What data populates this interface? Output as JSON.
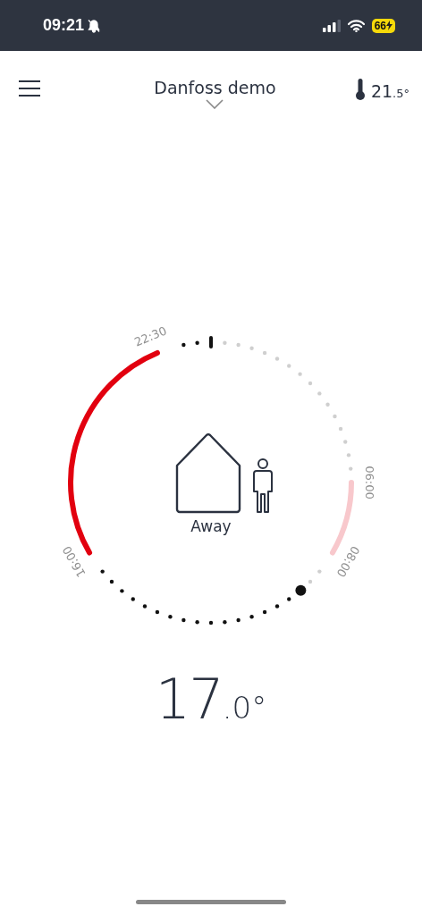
{
  "status_bar": {
    "time": "09:21",
    "battery": "66"
  },
  "header": {
    "title": "Danfoss demo",
    "room_temperature": {
      "whole": "21",
      "decimal": ".5°"
    }
  },
  "dial": {
    "periods": [
      {
        "start_label": "06:00",
        "end_label": "08:00",
        "color": "#f8c8cc"
      },
      {
        "start_label": "16:00",
        "end_label": "22:30",
        "color": "#e2000f"
      }
    ],
    "mode": "Away"
  },
  "setpoint": {
    "whole": "17",
    "decimal": ".0°"
  }
}
